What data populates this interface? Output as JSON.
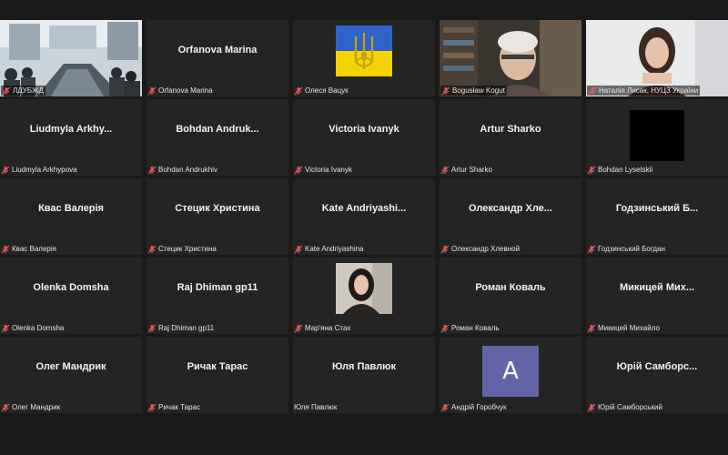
{
  "participants": [
    {
      "row": 0,
      "col": 0,
      "kind": "video-room",
      "label": "ЛДУБЖД"
    },
    {
      "row": 0,
      "col": 1,
      "kind": "name",
      "display": "Orfanova Marina",
      "label": "Orfanova Marina"
    },
    {
      "row": 0,
      "col": 2,
      "kind": "flag-avatar",
      "label": "Олеся Вацук"
    },
    {
      "row": 0,
      "col": 3,
      "kind": "video-man",
      "label": "Bogusław Kogut"
    },
    {
      "row": 0,
      "col": 4,
      "kind": "video-woman",
      "label": "Наталія Лисак, НУЦЗ України"
    },
    {
      "row": 1,
      "col": 0,
      "kind": "name",
      "display": "Liudmyla Arkhy...",
      "label": "Liudmyla Arkhypova"
    },
    {
      "row": 1,
      "col": 1,
      "kind": "name",
      "display": "Bohdan Andruk...",
      "label": "Bohdan Andrukhiv"
    },
    {
      "row": 1,
      "col": 2,
      "kind": "name",
      "display": "Victoria Ivanyk",
      "label": "Victoria Ivanyk"
    },
    {
      "row": 1,
      "col": 3,
      "kind": "name",
      "display": "Artur Sharko",
      "label": "Artur Sharko"
    },
    {
      "row": 1,
      "col": 4,
      "kind": "black-square",
      "label": "Bohdan Lysetskii"
    },
    {
      "row": 2,
      "col": 0,
      "kind": "name",
      "display": "Квас Валерія",
      "label": "Квас Валерія"
    },
    {
      "row": 2,
      "col": 1,
      "kind": "name",
      "display": "Стецик Христина",
      "label": "Стецик Христина"
    },
    {
      "row": 2,
      "col": 2,
      "kind": "name",
      "display": "Kate Andriyashi...",
      "label": "Kate Andriyashina"
    },
    {
      "row": 2,
      "col": 3,
      "kind": "name",
      "display": "Олександр Хле...",
      "label": "Олександр Хлевной"
    },
    {
      "row": 2,
      "col": 4,
      "kind": "name",
      "display": "Годзинський Б...",
      "label": "Годзинський Богдан"
    },
    {
      "row": 3,
      "col": 0,
      "kind": "name",
      "display": "Olenka Domsha",
      "label": "Olenka Domsha"
    },
    {
      "row": 3,
      "col": 1,
      "kind": "name",
      "display": "Raj Dhiman gp11",
      "label": "Raj Dhiman gp11"
    },
    {
      "row": 3,
      "col": 2,
      "kind": "photo-avatar",
      "label": "Мар'яна Стах"
    },
    {
      "row": 3,
      "col": 3,
      "kind": "name",
      "display": "Роман Коваль",
      "label": "Роман Коваль"
    },
    {
      "row": 3,
      "col": 4,
      "kind": "name",
      "display": "Микицей Мих...",
      "label": "Микицей Михайло"
    },
    {
      "row": 4,
      "col": 0,
      "kind": "name",
      "display": "Олег Мандрик",
      "label": "Олег Мандрик"
    },
    {
      "row": 4,
      "col": 1,
      "kind": "name",
      "display": "Ричак Тарас",
      "label": "Ричак Тарас"
    },
    {
      "row": 4,
      "col": 2,
      "kind": "name",
      "display": "Юля Павлюк",
      "label": "Юля Павлюк",
      "nomic": true
    },
    {
      "row": 4,
      "col": 3,
      "kind": "letter-avatar",
      "letter": "A",
      "label": "Андрій Горобчук"
    },
    {
      "row": 4,
      "col": 4,
      "kind": "name",
      "display": "Юрій Самборс...",
      "label": "Юрій Самборський"
    }
  ],
  "colors": {
    "background": "#1a1a1a",
    "tile": "#242424",
    "active_outline": "#d9e53a",
    "avatar": "#6264a7",
    "mic_muted": "#e35b5b"
  }
}
